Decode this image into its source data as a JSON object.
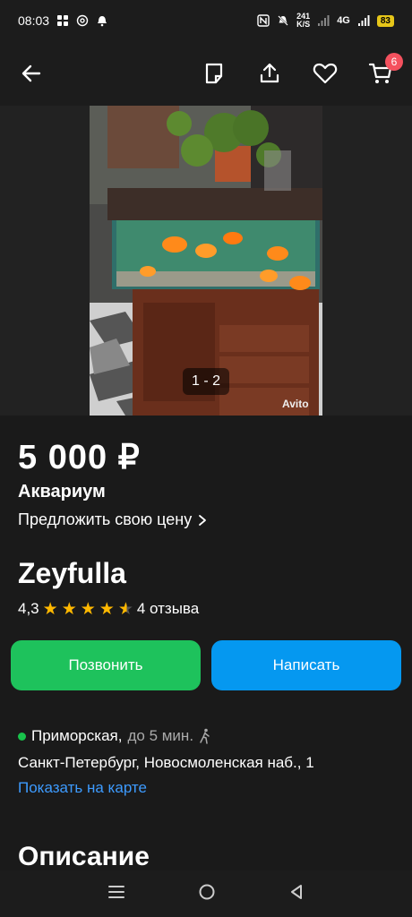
{
  "status_bar": {
    "time": "08:03",
    "speed_value": "241",
    "speed_unit": "K/S",
    "network": "4G",
    "battery": "83"
  },
  "toolbar": {
    "cart_count": "6"
  },
  "gallery": {
    "pager": "1 - 2",
    "watermark": "Avito"
  },
  "listing": {
    "price": "5 000 ₽",
    "title": "Аквариум",
    "offer_price": "Предложить свою цену"
  },
  "seller": {
    "name": "Zeyfulla",
    "rating": "4,3",
    "reviews": "4 отзыва",
    "rating_value": 4.3,
    "colors": {
      "star": "#ffb800"
    }
  },
  "actions": {
    "call": "Позвонить",
    "message": "Написать",
    "colors": {
      "call": "#1ec25c",
      "message": "#0598f0"
    }
  },
  "location": {
    "metro": "Приморская,",
    "walk_time": "до 5 мин.",
    "address": "Санкт-Петербург, Новосмоленская наб., 1",
    "map_link": "Показать на карте"
  },
  "description": {
    "heading": "Описание"
  }
}
